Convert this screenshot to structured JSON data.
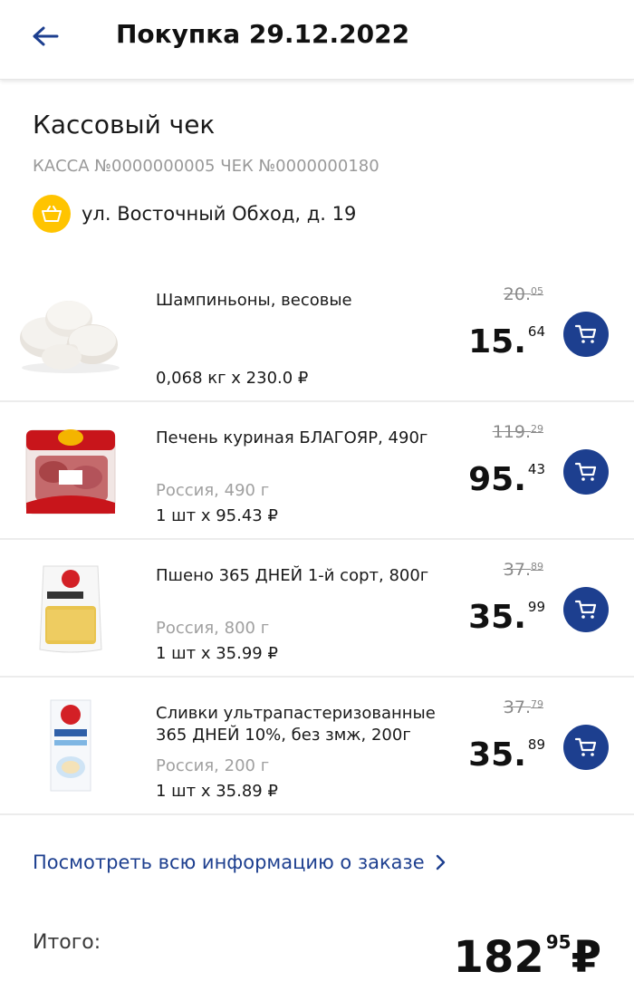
{
  "header": {
    "back_icon": "arrow-left-icon",
    "title": "Покупка 29.12.2022"
  },
  "receipt": {
    "title": "Кассовый чек",
    "meta": "КАССА №0000000005 ЧЕК №0000000180",
    "store_icon": "basket-icon",
    "store_address": "ул. Восточный Обход, д. 19"
  },
  "items": [
    {
      "name": "Шампиньоны, весовые",
      "origin": "",
      "qty": "0,068 кг х 230.0 ₽",
      "old_price_int": "20.",
      "old_price_frac": "05",
      "price_int": "15.",
      "price_frac": "64",
      "image": "mushrooms-image"
    },
    {
      "name": "Печень куриная БЛАГОЯР, 490г",
      "origin": "Россия, 490 г",
      "qty": "1 шт х 95.43 ₽",
      "old_price_int": "119.",
      "old_price_frac": "29",
      "price_int": "95.",
      "price_frac": "43",
      "image": "chicken-liver-pack-image"
    },
    {
      "name": "Пшено 365 ДНЕЙ 1-й сорт, 800г",
      "origin": "Россия, 800 г",
      "qty": "1 шт х 35.99 ₽",
      "old_price_int": "37.",
      "old_price_frac": "89",
      "price_int": "35.",
      "price_frac": "99",
      "image": "millet-pack-image"
    },
    {
      "name": "Сливки ультрапастеризованные 365 ДНЕЙ 10%, без змж, 200г",
      "origin": "Россия, 200 г",
      "qty": "1 шт х 35.89 ₽",
      "old_price_int": "37.",
      "old_price_frac": "79",
      "price_int": "35.",
      "price_frac": "89",
      "image": "cream-carton-image"
    }
  ],
  "more_link": "Посмотреть всю информацию о заказе",
  "total": {
    "label": "Итого:",
    "int": "182",
    "frac": "95",
    "currency": "₽"
  },
  "colors": {
    "brand_blue": "#1d3f8f",
    "badge_yellow": "#ffc400"
  }
}
